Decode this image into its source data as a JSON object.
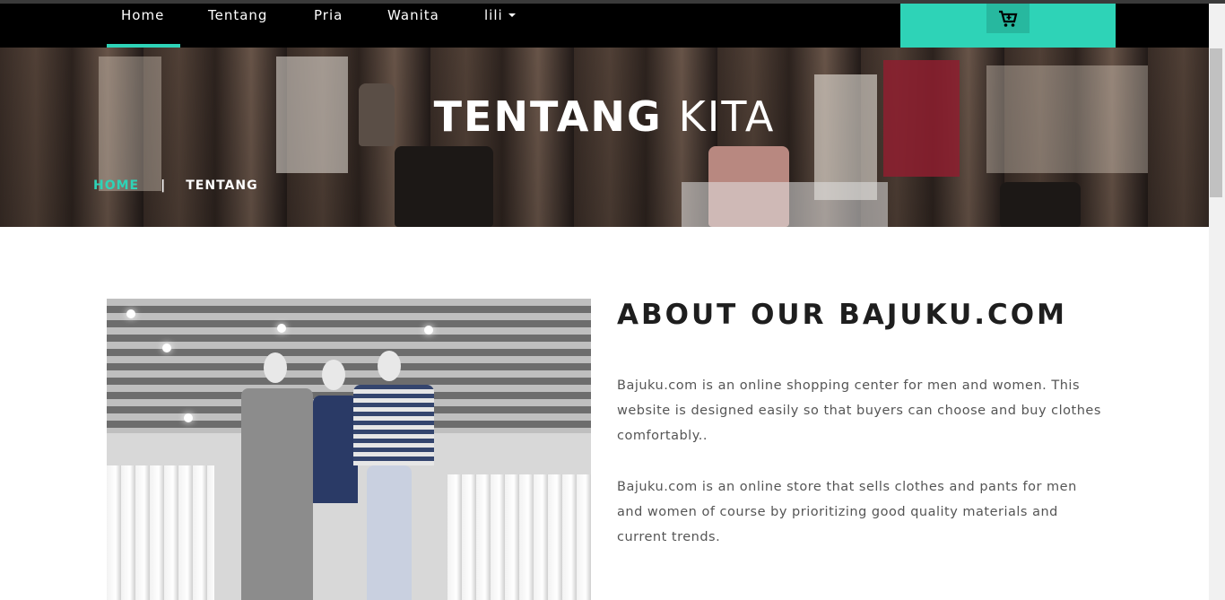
{
  "nav": {
    "items": [
      {
        "label": "Home",
        "active": true
      },
      {
        "label": "Tentang",
        "active": false
      },
      {
        "label": "Pria",
        "active": false
      },
      {
        "label": "Wanita",
        "active": false
      },
      {
        "label": "lili",
        "active": false,
        "dropdown": true
      }
    ],
    "cart_icon": "shopping-cart-icon"
  },
  "hero": {
    "title_bold": "TENTANG",
    "title_light": "KITA",
    "breadcrumb": {
      "home": "HOME",
      "separator": "|",
      "current": "TENTANG"
    }
  },
  "about": {
    "title": "ABOUT OUR BAJUKU.COM",
    "paragraphs": [
      "Bajuku.com is an online shopping center for men and women. This website is designed easily so that buyers can choose and buy clothes comfortably..",
      "Bajuku.com is an online store that sells clothes and pants for men and women of course by prioritizing good quality materials and current trends."
    ]
  },
  "colors": {
    "accent": "#2ed3b7",
    "navbar": "#000000",
    "text": "#555555"
  }
}
